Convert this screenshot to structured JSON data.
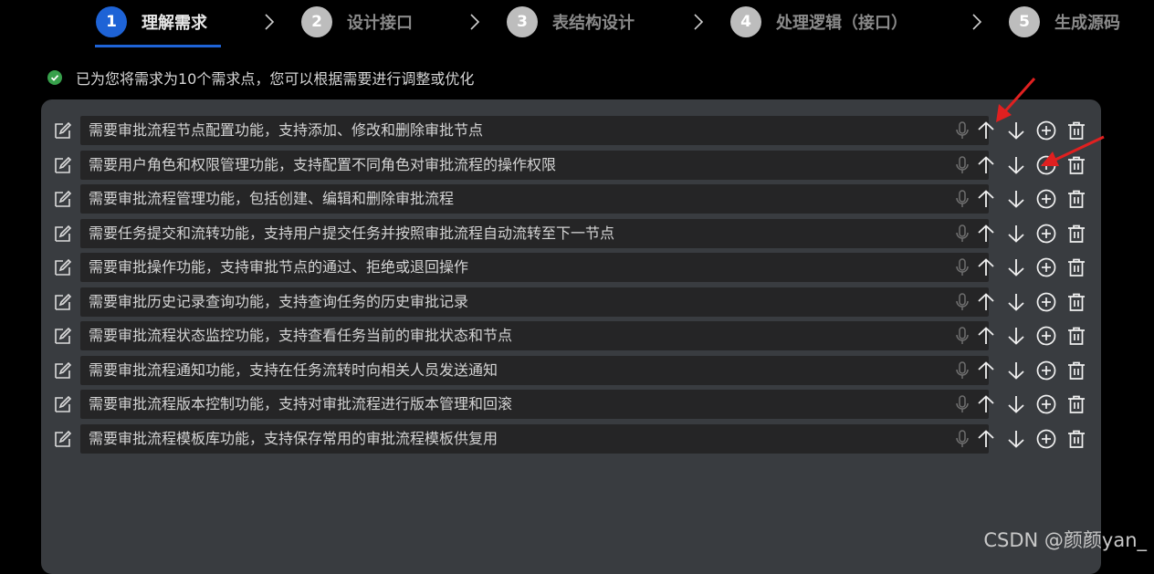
{
  "steps": [
    {
      "number": "1",
      "label": "理解需求",
      "active": true
    },
    {
      "number": "2",
      "label": "设计接口",
      "active": false
    },
    {
      "number": "3",
      "label": "表结构设计",
      "active": false
    },
    {
      "number": "4",
      "label": "处理逻辑（接口）",
      "active": false
    },
    {
      "number": "5",
      "label": "生成源码",
      "active": false
    }
  ],
  "status": {
    "text": "已为您将需求为10个需求点，您可以根据需要进行调整或优化",
    "color": "#37a04b"
  },
  "requirements": [
    "需要审批流程节点配置功能，支持添加、修改和删除审批节点",
    "需要用户角色和权限管理功能，支持配置不同角色对审批流程的操作权限",
    "需要审批流程管理功能，包括创建、编辑和删除审批流程",
    "需要任务提交和流转功能，支持用户提交任务并按照审批流程自动流转至下一节点",
    "需要审批操作功能，支持审批节点的通过、拒绝或退回操作",
    "需要审批历史记录查询功能，支持查询任务的历史审批记录",
    "需要审批流程状态监控功能，支持查看任务当前的审批状态和节点",
    "需要审批流程通知功能，支持在任务流转时向相关人员发送通知",
    "需要审批流程版本控制功能，支持对审批流程进行版本管理和回滚",
    "需要审批流程模板库功能，支持保存常用的审批流程模板供复用"
  ],
  "watermark": "CSDN @颜颜yan_",
  "colors": {
    "accent": "#1e63d6",
    "panel": "#393c40",
    "field": "#252526",
    "annotation": "#e02020"
  },
  "icons": {
    "edit": "edit-icon",
    "mic": "microphone-icon",
    "up": "arrow-up-icon",
    "down": "arrow-down-icon",
    "add": "add-circle-icon",
    "delete": "trash-icon"
  }
}
